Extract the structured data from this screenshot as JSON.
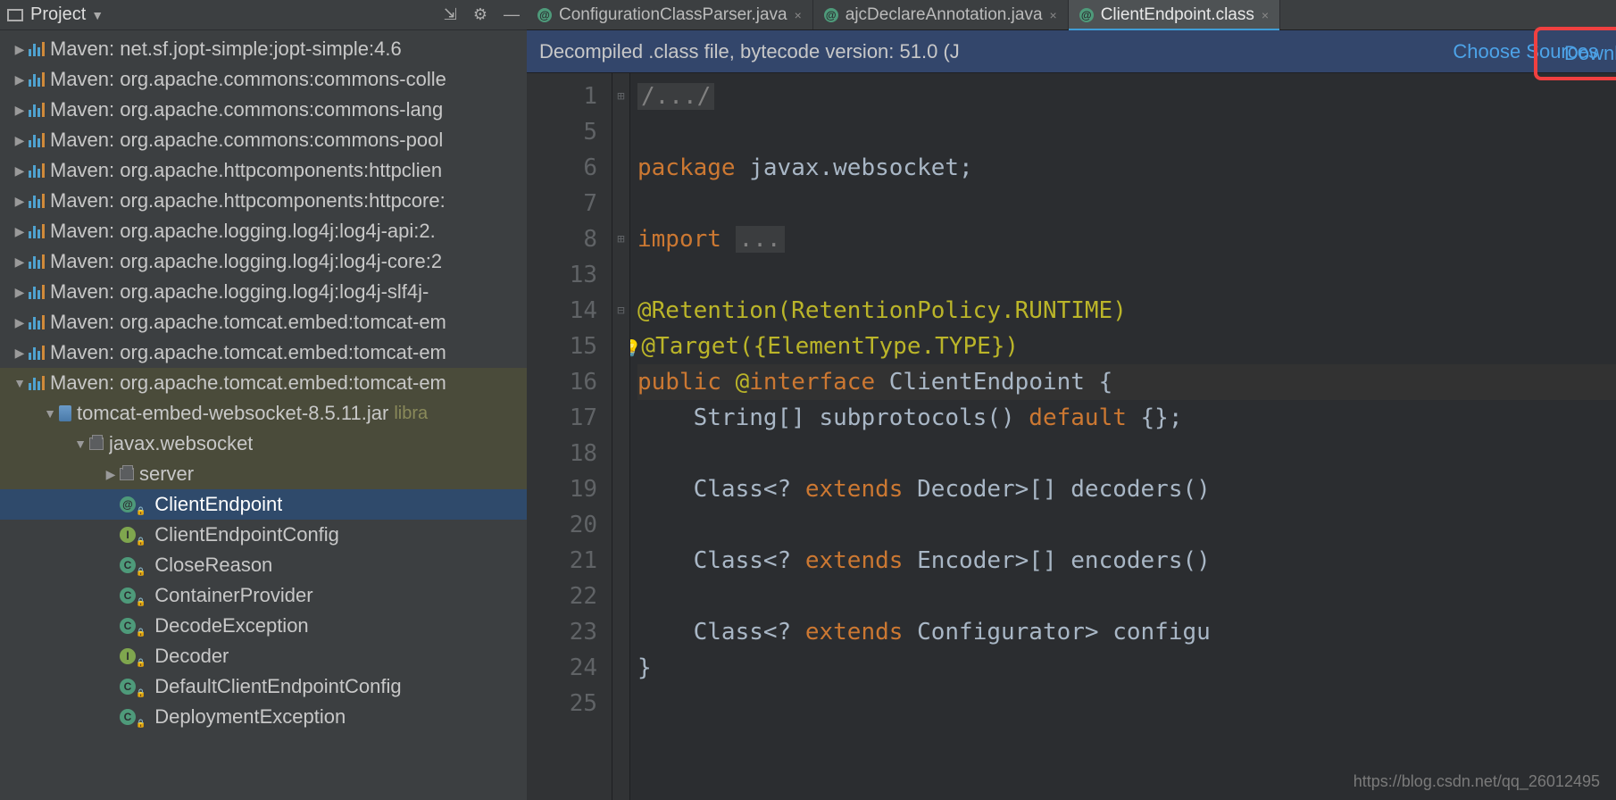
{
  "sidebar": {
    "title": "Project",
    "nodes": [
      {
        "indent": 0,
        "chev": "right",
        "icon": "maven",
        "label": "Maven: net.sf.jopt-simple:jopt-simple:4.6"
      },
      {
        "indent": 0,
        "chev": "right",
        "icon": "maven",
        "label": "Maven: org.apache.commons:commons-colle"
      },
      {
        "indent": 0,
        "chev": "right",
        "icon": "maven",
        "label": "Maven: org.apache.commons:commons-lang"
      },
      {
        "indent": 0,
        "chev": "right",
        "icon": "maven",
        "label": "Maven: org.apache.commons:commons-pool"
      },
      {
        "indent": 0,
        "chev": "right",
        "icon": "maven",
        "label": "Maven: org.apache.httpcomponents:httpclien"
      },
      {
        "indent": 0,
        "chev": "right",
        "icon": "maven",
        "label": "Maven: org.apache.httpcomponents:httpcore:"
      },
      {
        "indent": 0,
        "chev": "right",
        "icon": "maven",
        "label": "Maven: org.apache.logging.log4j:log4j-api:2."
      },
      {
        "indent": 0,
        "chev": "right",
        "icon": "maven",
        "label": "Maven: org.apache.logging.log4j:log4j-core:2"
      },
      {
        "indent": 0,
        "chev": "right",
        "icon": "maven",
        "label": "Maven: org.apache.logging.log4j:log4j-slf4j-"
      },
      {
        "indent": 0,
        "chev": "right",
        "icon": "maven",
        "label": "Maven: org.apache.tomcat.embed:tomcat-em"
      },
      {
        "indent": 0,
        "chev": "right",
        "icon": "maven",
        "label": "Maven: org.apache.tomcat.embed:tomcat-em"
      },
      {
        "indent": 0,
        "chev": "down",
        "icon": "maven",
        "label": "Maven: org.apache.tomcat.embed:tomcat-em",
        "hl": true
      },
      {
        "indent": 1,
        "chev": "down",
        "icon": "jar",
        "label": "tomcat-embed-websocket-8.5.11.jar",
        "suffix": "libra",
        "hl": true
      },
      {
        "indent": 2,
        "chev": "down",
        "icon": "pkg",
        "label": "javax.websocket",
        "hl": true
      },
      {
        "indent": 3,
        "chev": "right",
        "icon": "pkg",
        "label": "server",
        "hl": true
      },
      {
        "indent": 3,
        "chev": "none",
        "icon": "class-a",
        "label": "ClientEndpoint",
        "sel": true
      },
      {
        "indent": 3,
        "chev": "none",
        "icon": "class-i",
        "label": "ClientEndpointConfig"
      },
      {
        "indent": 3,
        "chev": "none",
        "icon": "class-c",
        "label": "CloseReason"
      },
      {
        "indent": 3,
        "chev": "none",
        "icon": "class-c",
        "label": "ContainerProvider"
      },
      {
        "indent": 3,
        "chev": "none",
        "icon": "class-c",
        "label": "DecodeException"
      },
      {
        "indent": 3,
        "chev": "none",
        "icon": "class-i",
        "label": "Decoder"
      },
      {
        "indent": 3,
        "chev": "none",
        "icon": "class-c",
        "label": "DefaultClientEndpointConfig"
      },
      {
        "indent": 3,
        "chev": "none",
        "icon": "class-c",
        "label": "DeploymentException"
      }
    ]
  },
  "tabs": [
    {
      "label": "ConfigurationClassParser.java",
      "active": false
    },
    {
      "label": "ajcDeclareAnnotation.java",
      "active": false
    },
    {
      "label": "ClientEndpoint.class",
      "active": true
    }
  ],
  "banner": {
    "text": "Decompiled .class file, bytecode version: 51.0 (J",
    "download": "Download Sources",
    "choose": "Choose Sources"
  },
  "gutter": [
    "1",
    "5",
    "6",
    "7",
    "8",
    "13",
    "14",
    "15",
    "16",
    "17",
    "18",
    "19",
    "20",
    "21",
    "22",
    "23",
    "24",
    "25"
  ],
  "code": {
    "l0": "/.../",
    "l2_kw": "package",
    "l2_rest": " javax.websocket;",
    "l4_kw": "import ",
    "l4_fold": "...",
    "l6": "@Retention(RetentionPolicy.RUNTIME)",
    "l7": "@Target({ElementType.TYPE})",
    "l8_pub": "public ",
    "l8_at": "@",
    "l8_int": "interface ",
    "l8_name": "ClientEndpoint ",
    "l8_brace": "{",
    "l9_a": "    String[] subprotocols() ",
    "l9_kw": "default",
    "l9_b": " {};",
    "l11_a": "    Class<? ",
    "l11_kw": "extends",
    "l11_b": " Decoder>[] decoders()",
    "l13_a": "    Class<? ",
    "l13_kw": "extends",
    "l13_b": " Encoder>[] encoders()",
    "l15_a": "    Class<? ",
    "l15_kw": "extends",
    "l15_b": " Configurator> configu",
    "l16": "}"
  },
  "watermark": "https://blog.csdn.net/qq_26012495"
}
